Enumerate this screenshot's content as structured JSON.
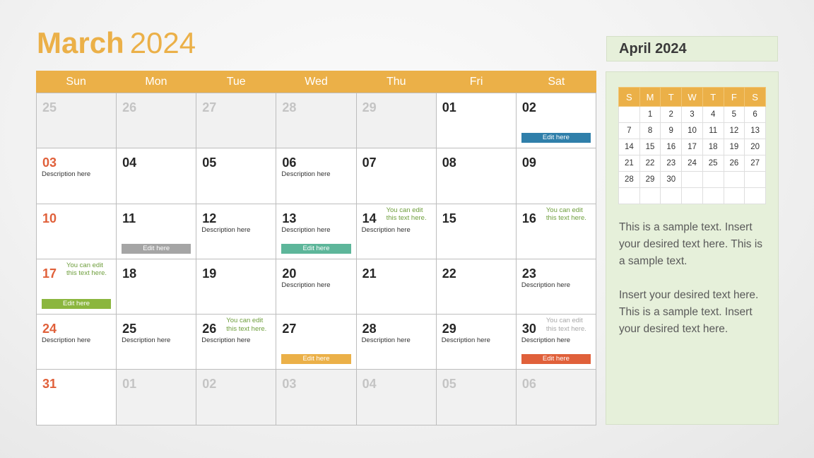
{
  "title": {
    "month": "March",
    "year": "2024"
  },
  "colors": {
    "accent": "#EBB048",
    "sunday": "#E0603A",
    "note_green": "#6E9E3C",
    "panel_bg": "#E6F0DA",
    "blue": "#2F7FAA",
    "gray": "#A5A5A5",
    "teal": "#5DB69A",
    "green": "#8BB63E",
    "orange": "#E0603A"
  },
  "weekdays": [
    "Sun",
    "Mon",
    "Tue",
    "Wed",
    "Thu",
    "Fri",
    "Sat"
  ],
  "weeks": [
    [
      {
        "day": "25",
        "other": true
      },
      {
        "day": "26",
        "other": true
      },
      {
        "day": "27",
        "other": true
      },
      {
        "day": "28",
        "other": true
      },
      {
        "day": "29",
        "other": true
      },
      {
        "day": "01"
      },
      {
        "day": "02",
        "edit": {
          "label": "Edit here",
          "color": "#2F7FAA"
        }
      }
    ],
    [
      {
        "day": "03",
        "desc": "Description here"
      },
      {
        "day": "04"
      },
      {
        "day": "05"
      },
      {
        "day": "06",
        "desc": "Description here"
      },
      {
        "day": "07"
      },
      {
        "day": "08"
      },
      {
        "day": "09"
      }
    ],
    [
      {
        "day": "10"
      },
      {
        "day": "11",
        "edit": {
          "label": "Edit here",
          "color": "#A5A5A5"
        }
      },
      {
        "day": "12",
        "desc": "Description here"
      },
      {
        "day": "13",
        "desc": "Description here",
        "edit": {
          "label": "Edit here",
          "color": "#5DB69A"
        }
      },
      {
        "day": "14",
        "desc": "Description here",
        "note": [
          "You can edit",
          "this text here."
        ]
      },
      {
        "day": "15"
      },
      {
        "day": "16",
        "note": [
          "You can edit",
          "this text here."
        ]
      }
    ],
    [
      {
        "day": "17",
        "note": [
          "You can edit",
          "this text here."
        ],
        "edit": {
          "label": "Edit here",
          "color": "#8BB63E"
        }
      },
      {
        "day": "18"
      },
      {
        "day": "19"
      },
      {
        "day": "20",
        "desc": "Description here"
      },
      {
        "day": "21"
      },
      {
        "day": "22"
      },
      {
        "day": "23",
        "desc": "Description here"
      }
    ],
    [
      {
        "day": "24",
        "desc": "Description here"
      },
      {
        "day": "25",
        "desc": "Description here"
      },
      {
        "day": "26",
        "desc": "Description here",
        "note": [
          "You can edit",
          "this text here."
        ]
      },
      {
        "day": "27",
        "edit": {
          "label": "Edit here",
          "color": "#EBB048"
        }
      },
      {
        "day": "28",
        "desc": "Description here"
      },
      {
        "day": "29",
        "desc": "Description here"
      },
      {
        "day": "30",
        "desc": "Description here",
        "note": [
          "You can edit",
          "this text here."
        ],
        "note_gray": true,
        "edit": {
          "label": "Edit here",
          "color": "#E0603A"
        }
      }
    ],
    [
      {
        "day": "31"
      },
      {
        "day": "01",
        "other": true
      },
      {
        "day": "02",
        "other": true
      },
      {
        "day": "03",
        "other": true
      },
      {
        "day": "04",
        "other": true
      },
      {
        "day": "05",
        "other": true
      },
      {
        "day": "06",
        "other": true
      }
    ]
  ],
  "sidebar": {
    "title": "April 2024",
    "mini_weekdays": [
      "S",
      "M",
      "T",
      "W",
      "T",
      "F",
      "S"
    ],
    "mini_weeks": [
      [
        "",
        "1",
        "2",
        "3",
        "4",
        "5",
        "6"
      ],
      [
        "7",
        "8",
        "9",
        "10",
        "11",
        "12",
        "13"
      ],
      [
        "14",
        "15",
        "16",
        "17",
        "18",
        "19",
        "20"
      ],
      [
        "21",
        "22",
        "23",
        "24",
        "25",
        "26",
        "27"
      ],
      [
        "28",
        "29",
        "30",
        "",
        "",
        "",
        ""
      ],
      [
        "",
        "",
        "",
        "",
        "",
        "",
        ""
      ]
    ],
    "paragraphs": [
      "This is a sample text. Insert your desired text here. This is a sample text.",
      "Insert your desired text here. This is a sample text. Insert your desired text here."
    ]
  }
}
